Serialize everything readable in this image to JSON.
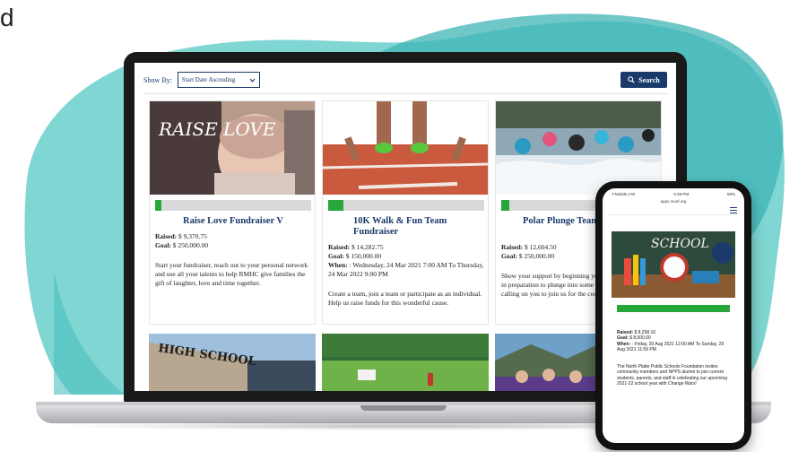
{
  "partial_heading": "d",
  "colors": {
    "teal": "#5fc9c5",
    "teal_dark": "#2fa8aa",
    "navy": "#1a3a6b",
    "green": "#27a63a"
  },
  "laptop": {
    "toolbar": {
      "show_by_label": "Show By:",
      "sort_value": "Start Date Ascending",
      "search_label": "Search",
      "search_icon": "search-icon",
      "dropdown_icon": "chevron-down-icon"
    },
    "cards": [
      {
        "title": "Raise Love Fundraiser V",
        "raised_label": "Raised:",
        "raised": "$ 9,370.75",
        "goal_label": "Goal:",
        "goal": "$ 250,000.00",
        "progress": 0.04,
        "description": "Start your fundraiser, reach out to your personal network and use all your talents to help RMHC give families the gift of laughter, love and time together.",
        "image_text": "RAISE LOVE"
      },
      {
        "title": "10K Walk & Fun Team Fundraiser",
        "raised_label": "Raised:",
        "raised": "$ 14,282.75",
        "goal_label": "Goal:",
        "goal": "$ 150,000.00",
        "when_label": "When:",
        "when": ": Wednesday, 24 Mar 2021 7:00 AM To Thursday, 24 Mar 2022 9:00 PM",
        "progress": 0.1,
        "description": "Create a team, join a team or participate as an individual. Help us raise funds for this wonderful cause."
      },
      {
        "title": "Polar Plunge Team Fundraising",
        "raised_label": "Raised:",
        "raised": "$ 12,604.50",
        "goal_label": "Goal:",
        "goal": "$ 250,000.00",
        "progress": 0.05,
        "description": "Show your support by beginning your fundraising efforts in preparation to plunge into some icy cold water! We are calling on you to join us for the coolest event..."
      }
    ],
    "row2_image_text": "HIGH SCHOOL"
  },
  "phone": {
    "status_left": "T-Mobile LTE",
    "status_time": "6:28 PM",
    "status_right": "58%",
    "url": "apps.rsoef.org",
    "image_text": "SCHOOL",
    "progress": 1.0,
    "raised_label": "Raised:",
    "raised": "$ 8,298.16",
    "goal_label": "Goal:",
    "goal": "$ 8,000.00",
    "when_label": "When:",
    "when": ": Friday, 20 Aug 2021 12:00 AM To Sunday, 29 Aug 2021 11:59 PM",
    "description": "The North Platte Public Schools Foundation invites community members and NPPS alumni to join current students, parents, and staff in celebrating our upcoming 2021-22 school year with Change Wars!"
  }
}
